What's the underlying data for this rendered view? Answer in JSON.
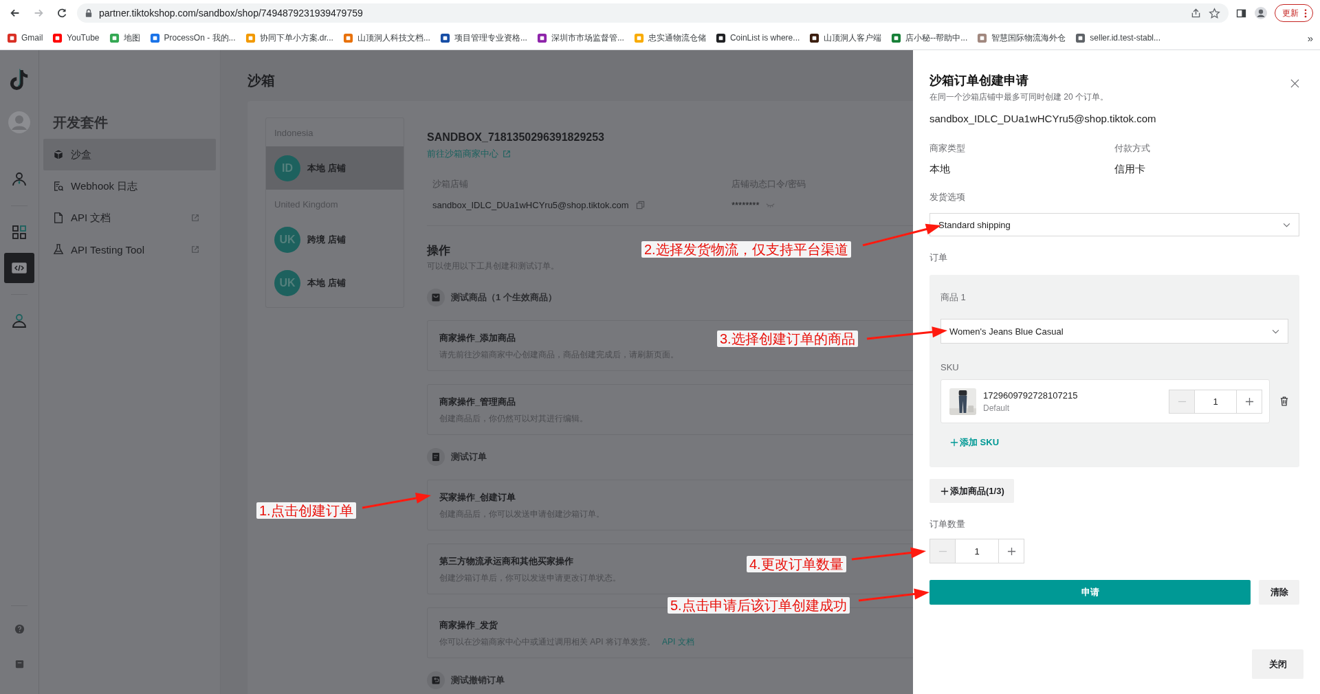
{
  "browser": {
    "forward_disabled": true,
    "url": "partner.tiktokshop.com/sandbox/shop/7494879231939479759",
    "update_button": "更新",
    "bookmarks": [
      "Gmail",
      "YouTube",
      "地图",
      "ProcessOn - 我的...",
      "协同下单小方案.dr...",
      "山顶洞人科技文档...",
      "项目管理专业资格...",
      "深圳市市场监督管...",
      "忠实通物流仓储",
      "CoinList is where...",
      "山顶洞人客户端",
      "店小秘--帮助中...",
      "智慧国际物流海外仓",
      "seller.id.test-stabl..."
    ],
    "more": "»"
  },
  "rail": {
    "items": [
      {
        "kind": "account",
        "selected": false
      },
      {
        "kind": "apps",
        "selected": false
      },
      {
        "kind": "develop",
        "selected": true
      },
      {
        "kind": "profile",
        "selected": false
      }
    ]
  },
  "sidebar": {
    "title": "开发套件",
    "items": [
      {
        "kind": "sandbox",
        "label": "沙盒",
        "selected": true,
        "external": false
      },
      {
        "kind": "webhook",
        "label": "Webhook 日志",
        "selected": false,
        "external": false
      },
      {
        "kind": "doc",
        "label": "API 文档",
        "selected": false,
        "external": true
      },
      {
        "kind": "test",
        "label": "API Testing Tool",
        "selected": false,
        "external": true
      }
    ]
  },
  "page": {
    "title": "沙箱",
    "stores": [
      {
        "region": "Indonesia",
        "stores": [
          {
            "badge": "ID",
            "name": "本地 店铺",
            "selected": true
          }
        ]
      },
      {
        "region": "United Kingdom",
        "stores": [
          {
            "badge": "UK",
            "name": "跨境 店铺",
            "selected": false
          },
          {
            "badge": "UK",
            "name": "本地 店铺",
            "selected": false
          }
        ]
      }
    ],
    "shop": {
      "name": "SANDBOX_7181350296391829253",
      "link": "前往沙箱商家中心",
      "fields": [
        {
          "kind": "copy",
          "label": "沙箱店铺",
          "value": "sandbox_IDLC_DUa1wHCYru5@shop.tiktok.com"
        },
        {
          "kind": "secret",
          "label": "店铺动态口令/密码",
          "value": "********"
        }
      ]
    },
    "operations": {
      "title": "操作",
      "subtitle": "可以使用以下工具创建和测试订单。",
      "sections": [
        {
          "kind": "bag",
          "title": "测试商品（1 个生效商品）",
          "cards": [
            {
              "title": "商家操作_添加商品",
              "desc": "请先前往沙箱商家中心创建商品，商品创建完成后，请刷新页面。"
            },
            {
              "title": "商家操作_管理商品",
              "desc": "创建商品后，你仍然可以对其进行编辑。"
            }
          ]
        },
        {
          "kind": "order",
          "title": "测试订单",
          "cards": [
            {
              "title": "买家操作_创建订单",
              "desc": "创建商品后，你可以发送申请创建沙箱订单。"
            },
            {
              "title": "第三方物流承运商和其他买家操作",
              "desc": "创建沙箱订单后，你可以发送申请更改订单状态。"
            },
            {
              "title": "商家操作_发货",
              "desc": "你可以在沙箱商家中心中或通过调用相关 API 将订单发货。",
              "link": "API 文档"
            }
          ]
        },
        {
          "kind": "undo",
          "title": "测试撤销订单"
        }
      ]
    }
  },
  "drawer": {
    "title": "沙箱订单创建申请",
    "subtitle": "在同一个沙箱店铺中最多可同时创建 20 个订单。",
    "account": "sandbox_IDLC_DUa1wHCYru5@shop.tiktok.com",
    "info": [
      {
        "label": "商家类型",
        "value": "本地"
      },
      {
        "label": "付款方式",
        "value": "信用卡"
      }
    ],
    "shipping": {
      "label": "发货选项",
      "value": "Standard shipping"
    },
    "order": {
      "label": "订单",
      "products": [
        {
          "label": "商品 1",
          "product": "Women's Jeans Blue Casual",
          "sku_label": "SKU",
          "skus": [
            {
              "id": "1729609792728107215",
              "variant": "Default",
              "quantity": "1",
              "decrease_disabled": true
            }
          ],
          "add_sku": "添加 SKU"
        }
      ],
      "add_product": "添加商品(1/3)"
    },
    "quantity": {
      "label": "订单数量",
      "value": "1",
      "decrease_disabled": true
    },
    "submit": "申请",
    "clear": "清除",
    "close": "关闭"
  },
  "annotations": [
    {
      "text": "1.点击创建订单"
    },
    {
      "text": "2.选择发货物流，仅支持平台渠道"
    },
    {
      "text": "3.选择创建订单的商品"
    },
    {
      "text": "4.更改订单数量"
    },
    {
      "text": "5.点击申请后该订单创建成功"
    }
  ]
}
